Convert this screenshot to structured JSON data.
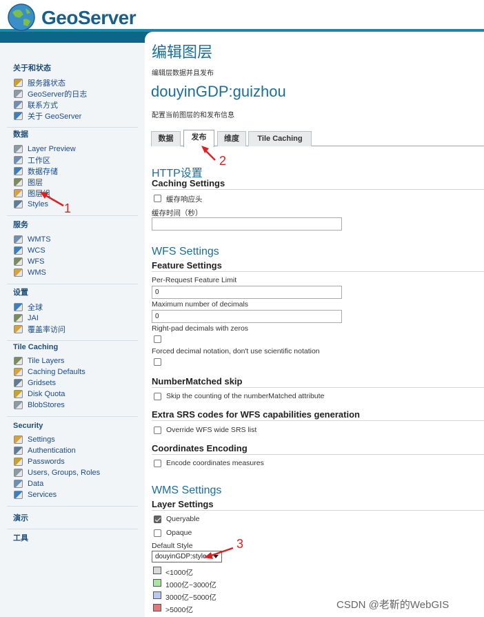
{
  "header": {
    "brand": "GeoServer"
  },
  "sidebar": {
    "sections": [
      {
        "title": "关于和状态",
        "items": [
          "服务器状态",
          "GeoServer的日志",
          "联系方式",
          "关于 GeoServer"
        ]
      },
      {
        "title": "数据",
        "items": [
          "Layer Preview",
          "工作区",
          "数据存储",
          "图层",
          "图层组",
          "Styles"
        ]
      },
      {
        "title": "服务",
        "items": [
          "WMTS",
          "WCS",
          "WFS",
          "WMS"
        ]
      },
      {
        "title": "设置",
        "items": [
          "全球",
          "JAI",
          "覆盖率访问"
        ]
      },
      {
        "title": "Tile Caching",
        "items": [
          "Tile Layers",
          "Caching Defaults",
          "Gridsets",
          "Disk Quota",
          "BlobStores"
        ]
      },
      {
        "title": "Security",
        "items": [
          "Settings",
          "Authentication",
          "Passwords",
          "Users, Groups, Roles",
          "Data",
          "Services"
        ]
      },
      {
        "title": "演示",
        "items": []
      },
      {
        "title": "工具",
        "items": []
      }
    ]
  },
  "main": {
    "title": "编辑图层",
    "subtitle": "编辑层数据并且发布",
    "layer_name": "douyinGDP:guizhou",
    "layer_subtitle": "配置当前图层的和发布信息",
    "tabs": [
      "数据",
      "发布",
      "维度",
      "Tile Caching"
    ],
    "active_tab": "发布",
    "http": {
      "heading": "HTTP设置",
      "subheading": "Caching Settings",
      "cache_headers_label": "缓存响应头",
      "cache_headers_checked": false,
      "cache_time_label": "缓存时间（秒）",
      "cache_time_value": ""
    },
    "wfs": {
      "heading": "WFS Settings",
      "subheading": "Feature Settings",
      "feature_limit_label": "Per-Request Feature Limit",
      "feature_limit_value": "0",
      "max_decimals_label": "Maximum number of decimals",
      "max_decimals_value": "0",
      "right_pad_label": "Right-pad decimals with zeros",
      "forced_decimal_label": "Forced decimal notation, don't use scientific notation",
      "number_matched_heading": "NumberMatched skip",
      "number_matched_label": "Skip the counting of the numberMatched attribute",
      "extra_srs_heading": "Extra SRS codes for WFS capabilities generation",
      "extra_srs_label": "Override WFS wide SRS list",
      "coords_heading": "Coordinates Encoding",
      "coords_label": "Encode coordinates measures"
    },
    "wms": {
      "heading": "WMS Settings",
      "subheading": "Layer Settings",
      "queryable_label": "Queryable",
      "queryable_checked": true,
      "opaque_label": "Opaque",
      "opaque_checked": false,
      "default_style_label": "Default Style",
      "default_style_value": "douyinGDP:style",
      "legend": [
        {
          "label": "<1000亿",
          "color": "#d9d9d9"
        },
        {
          "label": "1000亿~3000亿",
          "color": "#a8e6a1"
        },
        {
          "label": "3000亿~5000亿",
          "color": "#b9c9f0"
        },
        {
          "label": ">5000亿",
          "color": "#e07a7a"
        }
      ]
    }
  },
  "annotations": [
    "1",
    "2",
    "3"
  ],
  "watermark": "CSDN @老靳的WebGIS",
  "colors": {
    "accent": "#1a6e9c",
    "header_bar": "#0b6688",
    "annotation": "#e02020"
  }
}
